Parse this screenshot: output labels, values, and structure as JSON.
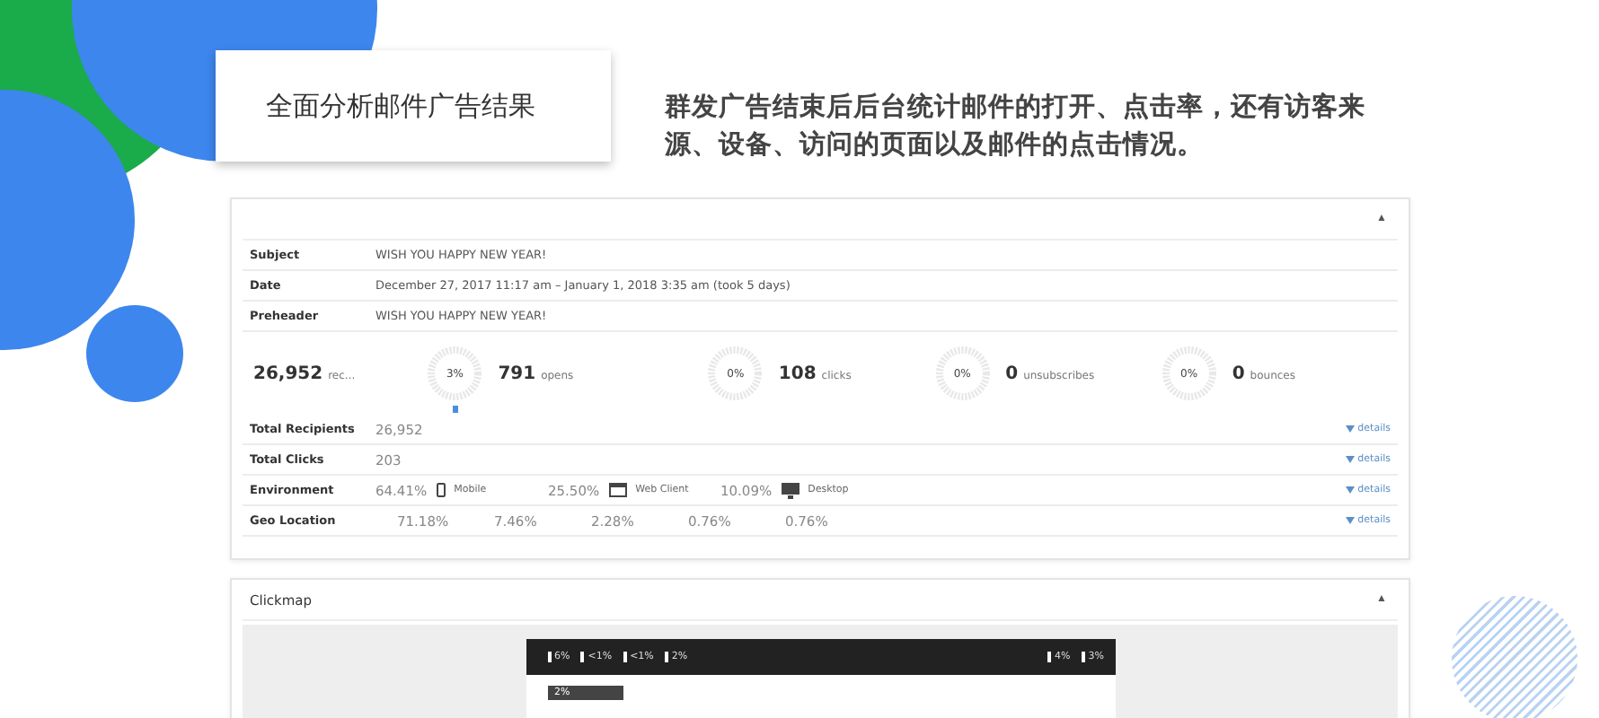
{
  "title_card": {
    "title": "全面分析邮件广告结果"
  },
  "description": "群发广告结束后后台统计邮件的打开、点击率，还有访客来源、设备、访问的页面以及邮件的点击情况。",
  "summary_panel": {
    "toggle": "▲",
    "fields": [
      {
        "label": "Subject",
        "value": "WISH YOU HAPPY NEW YEAR!"
      },
      {
        "label": "Date",
        "value": "December 27, 2017 11:17 am – January 1, 2018 3:35 am (took 5 days)"
      },
      {
        "label": "Preheader",
        "value": "WISH YOU HAPPY NEW YEAR!"
      }
    ],
    "stats": [
      {
        "kind": "plain",
        "number": "26,952",
        "label": "rec..."
      },
      {
        "kind": "ring",
        "percent": "3%",
        "number": "791",
        "label": "opens",
        "marker": true
      },
      {
        "kind": "ring",
        "percent": "0%",
        "number": "108",
        "label": "clicks",
        "marker": false
      },
      {
        "kind": "ring",
        "percent": "0%",
        "number": "0",
        "label": "unsubscribes",
        "marker": false
      },
      {
        "kind": "ring",
        "percent": "0%",
        "number": "0",
        "label": "bounces",
        "marker": false
      }
    ],
    "details": [
      {
        "kind": "text",
        "label": "Total Recipients",
        "value": "26,952",
        "link": "details"
      },
      {
        "kind": "text",
        "label": "Total Clicks",
        "value": "203",
        "link": "details"
      },
      {
        "kind": "devices",
        "label": "Environment",
        "items": [
          {
            "percent": "64.41%",
            "kind": "mobile",
            "name": "Mobile"
          },
          {
            "percent": "25.50%",
            "kind": "web",
            "name": "Web Client"
          },
          {
            "percent": "10.09%",
            "kind": "desktop",
            "name": "Desktop"
          }
        ],
        "link": "details"
      },
      {
        "kind": "list",
        "label": "Geo Location",
        "values": [
          "71.18%",
          "7.46%",
          "2.28%",
          "0.76%",
          "0.76%"
        ],
        "link": "details"
      }
    ]
  },
  "clickmap": {
    "title": "Clickmap",
    "toggle": "▲",
    "left_labels": [
      "6%",
      "<1%",
      "<1%",
      "2%"
    ],
    "right_labels": [
      "4%",
      "3%"
    ],
    "body_labels": [
      "2%"
    ]
  }
}
